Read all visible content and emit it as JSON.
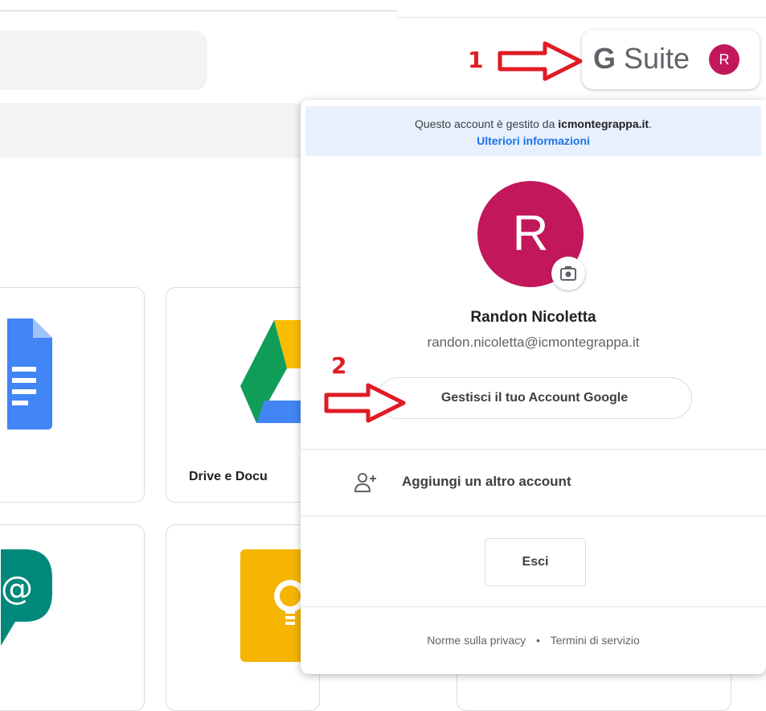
{
  "gsuite": {
    "logo_g": "G",
    "logo_text": " Suite",
    "avatar_letter": "R"
  },
  "annotations": {
    "step1": "1",
    "step2": "2"
  },
  "apps": {
    "drive_label": "Drive e Docu"
  },
  "account_panel": {
    "managed_prefix": "Questo account è gestito da ",
    "managed_domain": "icmontegrappa.it",
    "managed_suffix": ".",
    "more_info": "Ulteriori informazioni",
    "avatar_letter": "R",
    "user_name": "Randon Nicoletta",
    "user_email": "randon.nicoletta@icmontegrappa.it",
    "manage_account": "Gestisci il tuo Account Google",
    "add_account": "Aggiungi un altro account",
    "sign_out": "Esci",
    "privacy": "Norme sulla privacy",
    "separator": "•",
    "terms": "Termini di servizio"
  },
  "colors": {
    "avatar_bg": "#c2185b",
    "link_blue": "#1a73e8",
    "annotation_red": "#e01b24",
    "managed_bg": "#e8f0fe"
  },
  "icons": [
    "apps-grid-icon",
    "camera-icon",
    "add-person-icon",
    "google-docs-icon",
    "google-drive-icon",
    "hangouts-chat-icon",
    "google-keep-icon",
    "red-arrow-icon"
  ]
}
